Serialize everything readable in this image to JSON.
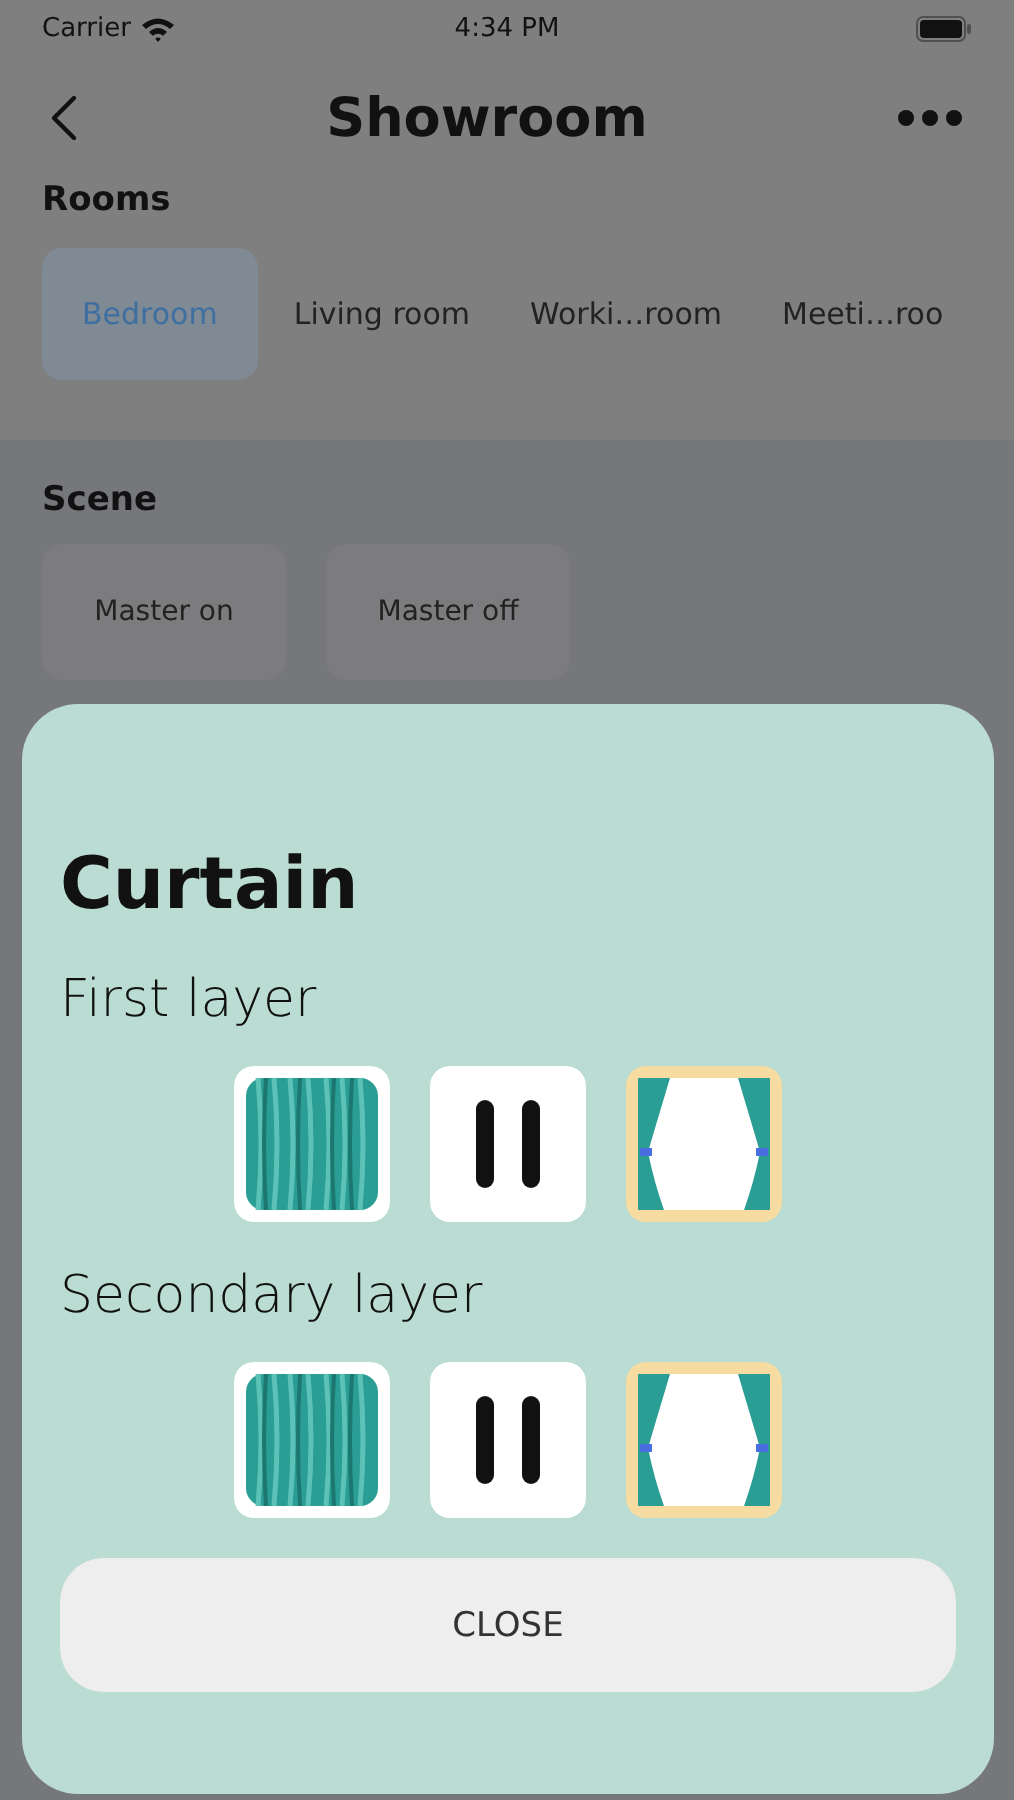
{
  "status_bar": {
    "carrier": "Carrier",
    "time": "4:34 PM"
  },
  "header": {
    "title": "Showroom"
  },
  "rooms": {
    "heading": "Rooms",
    "items": [
      {
        "label": "Bedroom",
        "selected": true
      },
      {
        "label": "Living room",
        "selected": false
      },
      {
        "label": "Worki…room",
        "selected": false
      },
      {
        "label": "Meeti…roo",
        "selected": false
      }
    ]
  },
  "scene": {
    "heading": "Scene",
    "items": [
      {
        "label": "Master on"
      },
      {
        "label": "Master off"
      }
    ]
  },
  "sheet": {
    "title": "Curtain",
    "layers": [
      {
        "label": "First layer",
        "controls": [
          {
            "kind": "close",
            "selected": false
          },
          {
            "kind": "stop",
            "selected": false
          },
          {
            "kind": "open",
            "selected": true
          }
        ]
      },
      {
        "label": "Secondary layer",
        "controls": [
          {
            "kind": "close",
            "selected": false
          },
          {
            "kind": "stop",
            "selected": false
          },
          {
            "kind": "open",
            "selected": true
          }
        ]
      }
    ],
    "close_button": "CLOSE"
  }
}
